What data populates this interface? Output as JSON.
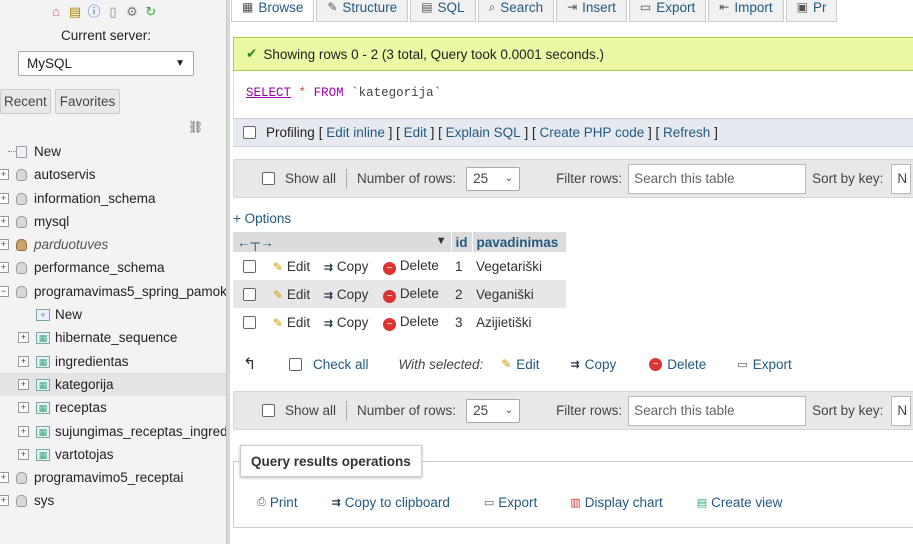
{
  "nav": {
    "icons": [
      "home-icon",
      "db-icon",
      "info-icon",
      "docs-icon",
      "settings-icon",
      "reload-icon"
    ],
    "server_label": "Current server:",
    "server_value": "MySQL",
    "tab_recent": "Recent",
    "tab_favorites": "Favorites",
    "tree": [
      {
        "label": "New",
        "kind": "new"
      },
      {
        "label": "autoservis",
        "kind": "db"
      },
      {
        "label": "information_schema",
        "kind": "db"
      },
      {
        "label": "mysql",
        "kind": "db"
      },
      {
        "label": "parduotuves",
        "kind": "db-italic"
      },
      {
        "label": "performance_schema",
        "kind": "db"
      },
      {
        "label": "programavimas5_spring_pamokos",
        "kind": "db-open"
      },
      {
        "label": "New",
        "kind": "child-new"
      },
      {
        "label": "hibernate_sequence",
        "kind": "child"
      },
      {
        "label": "ingredientas",
        "kind": "child"
      },
      {
        "label": "kategorija",
        "kind": "child-selected"
      },
      {
        "label": "receptas",
        "kind": "child"
      },
      {
        "label": "sujungimas_receptas_ingredientas",
        "kind": "child"
      },
      {
        "label": "vartotojas",
        "kind": "child"
      },
      {
        "label": "programavimo5_receptai",
        "kind": "db"
      },
      {
        "label": "sys",
        "kind": "db"
      }
    ]
  },
  "tabs": [
    "Browse",
    "Structure",
    "SQL",
    "Search",
    "Insert",
    "Export",
    "Import",
    "Pr"
  ],
  "success_message": "Showing rows 0 - 2 (3 total, Query took 0.0001 seconds.)",
  "sql": {
    "select": "SELECT",
    "star": "*",
    "from": "FROM",
    "table": "`kategorija`"
  },
  "profiling": {
    "label": "Profiling",
    "links": [
      "Edit inline",
      "Edit",
      "Explain SQL",
      "Create PHP code",
      "Refresh"
    ]
  },
  "navbar": {
    "show_all": "Show all",
    "rows_label": "Number of rows:",
    "rows_value": "25",
    "filter_label": "Filter rows:",
    "filter_placeholder": "Search this table",
    "sort_label": "Sort by key:",
    "sort_value": "N"
  },
  "options_link": "+ Options",
  "columns": [
    "id",
    "pavadinimas"
  ],
  "row_actions": {
    "edit": "Edit",
    "copy": "Copy",
    "delete": "Delete"
  },
  "rows": [
    {
      "id": "1",
      "pavadinimas": "Vegetariški"
    },
    {
      "id": "2",
      "pavadinimas": "Veganiški"
    },
    {
      "id": "3",
      "pavadinimas": "Azijietiški"
    }
  ],
  "with_selected": {
    "check_all": "Check all",
    "label": "With selected:",
    "edit": "Edit",
    "copy": "Copy",
    "delete": "Delete",
    "export": "Export"
  },
  "query_ops": {
    "title": "Query results operations",
    "print": "Print",
    "copy": "Copy to clipboard",
    "export": "Export",
    "chart": "Display chart",
    "view": "Create view"
  }
}
